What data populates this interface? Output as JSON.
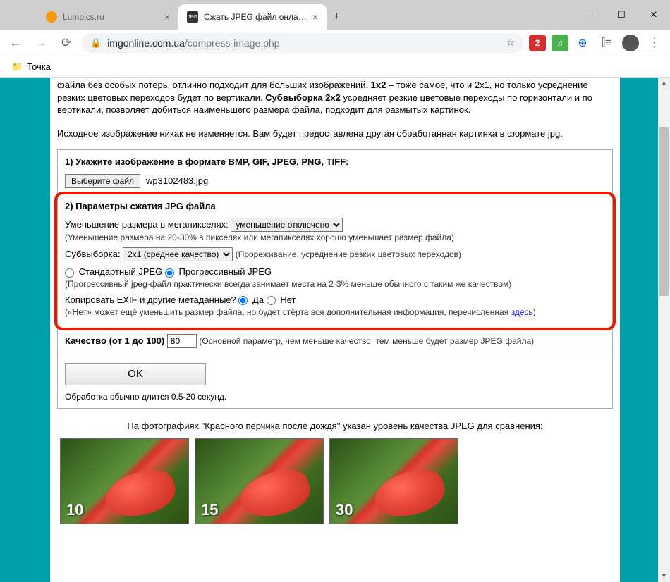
{
  "window": {
    "tabs": [
      {
        "title": "Lumpics.ru"
      },
      {
        "title": "Сжать JPEG файл онлайн - IMG"
      }
    ]
  },
  "toolbar": {
    "url_host": "imgonline.com.ua",
    "url_path": "/compress-image.php",
    "ext_badge": "2"
  },
  "bookmarks": {
    "item1": "Точка"
  },
  "content": {
    "intro_p1_a": "файла без особых потерь, отлично подходит для больших изображений. ",
    "intro_bold1": "1x2",
    "intro_p1_b": " – тоже самое, что и 2x1, но только усреднение резких цветовых переходов будет по вертикали. ",
    "intro_bold2": "Субвыборка 2x2",
    "intro_p1_c": " усредняет резкие цветовые переходы по горизонтали и по вертикали, позволяет добиться наименьшего размера файла, подходит для размытых картинок.",
    "note": "Исходное изображение никак не изменяется. Вам будет предоставлена другая обработанная картинка в формате jpg.",
    "section1_title": "1) Укажите изображение в формате BMP, GIF, JPEG, PNG, TIFF:",
    "file_button": "Выберите файл",
    "file_name": "wp3102483.jpg",
    "section2_title": "2) Параметры сжатия JPG файла",
    "mp_label": "Уменьшение размера в мегапикселях:",
    "mp_select": "уменьшение отключено",
    "mp_hint": "(Уменьшение размера на 20-30% в пикселях или мегапикселях хорошо уменьшает размер файла)",
    "sub_label": "Субвыборка:",
    "sub_select": "2x1 (среднее качество)",
    "sub_hint": "(Прореживание, усреднение резких цветовых переходов)",
    "jpeg_std": "Стандартный JPEG",
    "jpeg_prog": "Прогрессивный JPEG",
    "jpeg_hint": "(Прогрессивный jpeg-файл практически всегда занимает места на 2-3% меньше обычного с таким же качеством)",
    "exif_label": "Копировать EXIF и другие метаданные?",
    "exif_yes": "Да",
    "exif_no": "Нет",
    "exif_hint_a": "(«Нет» может ещё уменьшить размер файла, но будет стёрта вся дополнительная информация, перечисленная ",
    "exif_link": "здесь",
    "exif_hint_b": ")",
    "quality_label": "Качество (от 1 до 100)",
    "quality_value": "80",
    "quality_hint": "(Основной параметр, чем меньше качество, тем меньше будет размер JPEG файла)",
    "ok_button": "OK",
    "ok_hint": "Обработка обычно длится 0.5-20 секунд.",
    "gallery_caption": "На фотографиях \"Красного перчика после дождя\" указан уровень качества JPEG для сравнения:",
    "thumbs": [
      "10",
      "15",
      "30"
    ]
  }
}
